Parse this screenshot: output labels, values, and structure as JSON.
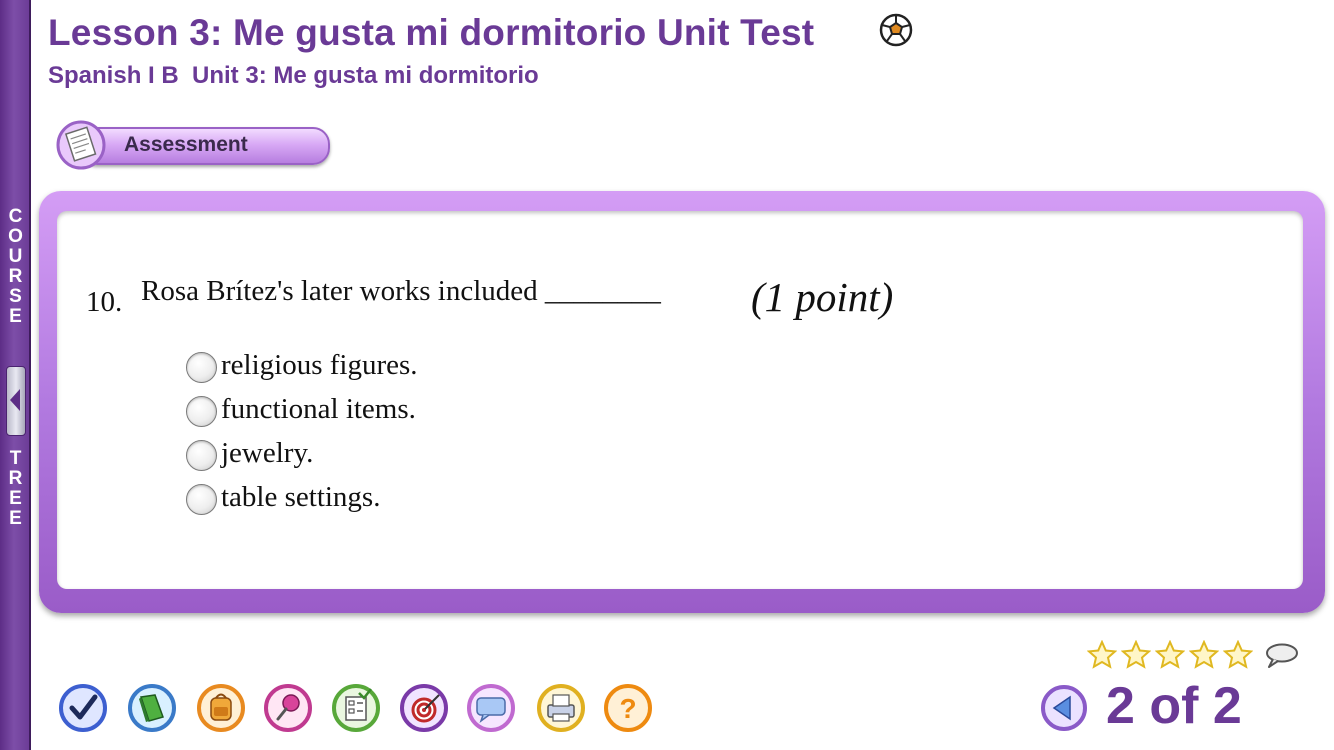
{
  "header": {
    "lesson_title": "Lesson 3: Me gusta mi dormitorio Unit Test",
    "course_subtitle": "Spanish I B  Unit 3: Me gusta mi dormitorio"
  },
  "sidebar": {
    "label_top": [
      "C",
      "O",
      "U",
      "R",
      "S",
      "E"
    ],
    "label_bottom": [
      "T",
      "R",
      "E",
      "E"
    ]
  },
  "section": {
    "label": "Assessment"
  },
  "question": {
    "number": "10.",
    "stem": "Rosa Brítez's later works included ________",
    "points": "(1 point)",
    "options": [
      {
        "label": "religious figures.",
        "selected": false
      },
      {
        "label": "functional items.",
        "selected": false
      },
      {
        "label": "jewelry.",
        "selected": false
      },
      {
        "label": "table settings.",
        "selected": false
      }
    ]
  },
  "rating": {
    "stars_total": 5,
    "stars_filled": 0
  },
  "toolbar": {
    "tools": [
      {
        "name": "check-icon",
        "color": "#3d5fd0"
      },
      {
        "name": "book-icon",
        "color": "#3aa040"
      },
      {
        "name": "backpack-icon",
        "color": "#e88a20"
      },
      {
        "name": "pushpin-icon",
        "color": "#c03a90"
      },
      {
        "name": "checklist-icon",
        "color": "#58a83a"
      },
      {
        "name": "target-icon",
        "color": "#7a3aa8"
      },
      {
        "name": "message-icon",
        "color": "#8a6ad8"
      },
      {
        "name": "print-icon",
        "color": "#e0b020"
      },
      {
        "name": "help-icon",
        "color": "#ee8a10"
      }
    ]
  },
  "pager": {
    "text": "2 of 2"
  },
  "colors": {
    "brand_purple": "#6a3a96",
    "frame_purple": "#b27ae0"
  }
}
